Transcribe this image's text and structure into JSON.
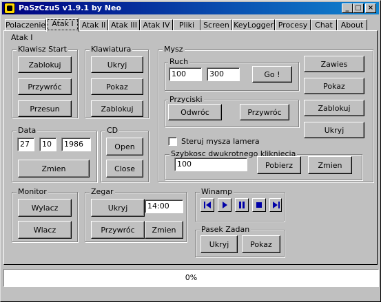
{
  "window": {
    "title": "PaSzCzuS v1.9.1 by Neo"
  },
  "tabs": [
    "Polaczenie",
    "Atak I",
    "Atak II",
    "Atak III",
    "Atak IV",
    "Pliki",
    "Screen",
    "KeyLogger",
    "Procesy",
    "Chat",
    "About"
  ],
  "active_tab": "Atak I",
  "panel_title": "Atak I",
  "klawisz_start": {
    "label": "Klawisz Start",
    "btn_block": "Zablokuj",
    "btn_restore": "Przywróc",
    "btn_move": "Przesun"
  },
  "klawiatura": {
    "label": "Klawiatura",
    "btn_hide": "Ukryj",
    "btn_show": "Pokaz",
    "btn_block": "Zablokuj"
  },
  "mysz": {
    "label": "Mysz",
    "ruch": {
      "label": "Ruch",
      "x": "100",
      "y": "300",
      "btn_go": "Go !"
    },
    "przyciski": {
      "label": "Przyciski",
      "btn_invert": "Odwróc",
      "btn_restore": "Przywróc"
    },
    "steruj": {
      "label": "Steruj mysza lamera",
      "checked": false
    },
    "dblclick": {
      "label": "Szybkosc dwukrotnego klikniecia",
      "value": "100",
      "btn_get": "Pobierz",
      "btn_change": "Zmien"
    },
    "btn_hang": "Zawies",
    "btn_show": "Pokaz",
    "btn_block": "Zablokuj",
    "btn_hide": "Ukryj"
  },
  "data": {
    "label": "Data",
    "day": "27",
    "month": "10",
    "year": "1986",
    "btn_change": "Zmien"
  },
  "cd": {
    "label": "CD",
    "btn_open": "Open",
    "btn_close": "Close"
  },
  "monitor": {
    "label": "Monitor",
    "btn_off": "Wylacz",
    "btn_on": "Wlacz"
  },
  "zegar": {
    "label": "Zegar",
    "btn_hide": "Ukryj",
    "time": "14:00",
    "btn_restore": "Przywróc",
    "btn_change": "Zmien"
  },
  "winamp": {
    "label": "Winamp",
    "controls": [
      "previous-icon",
      "play-icon",
      "pause-icon",
      "stop-icon",
      "next-icon"
    ],
    "icon_color": "#0000a8"
  },
  "pasek": {
    "label": "Pasek Zadan",
    "btn_hide": "Ukryj",
    "btn_show": "Pokaz"
  },
  "status": {
    "progress": "0%"
  },
  "colors": {
    "title_start": "#000080",
    "title_end": "#1084d0",
    "face": "#c0c0c0"
  }
}
